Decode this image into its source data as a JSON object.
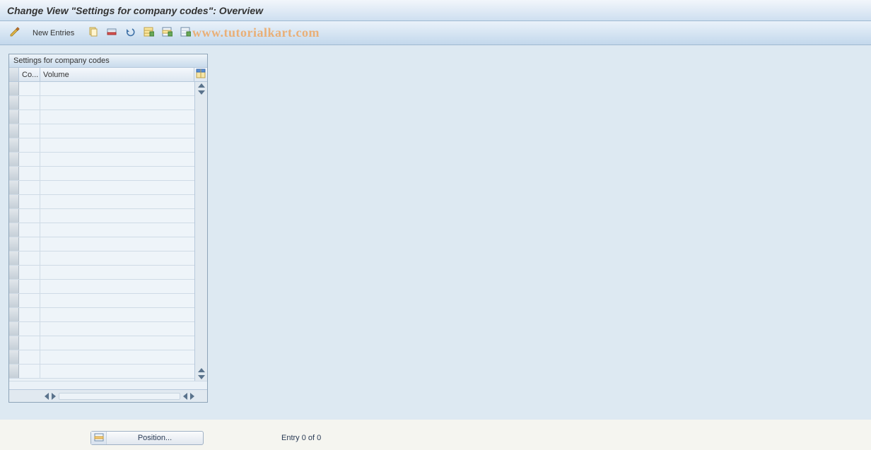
{
  "header": {
    "title": "Change View \"Settings for company codes\": Overview"
  },
  "toolbar": {
    "new_entries_label": "New Entries"
  },
  "watermark": {
    "text": "www.tutorialkart.com"
  },
  "panel": {
    "title": "Settings for company codes",
    "columns": {
      "co": "Co...",
      "volume": "Volume"
    },
    "row_count": 21
  },
  "footer": {
    "position_label": "Position...",
    "entry_status": "Entry 0 of 0"
  },
  "icons": {
    "toggle": "toggle-display-change-icon",
    "copy": "copy-icon",
    "deleterow": "delete-row-icon",
    "undo": "undo-icon",
    "selectall": "select-all-icon",
    "selectblock": "select-block-icon",
    "deselect": "deselect-all-icon",
    "config": "table-settings-icon",
    "position": "position-icon"
  }
}
